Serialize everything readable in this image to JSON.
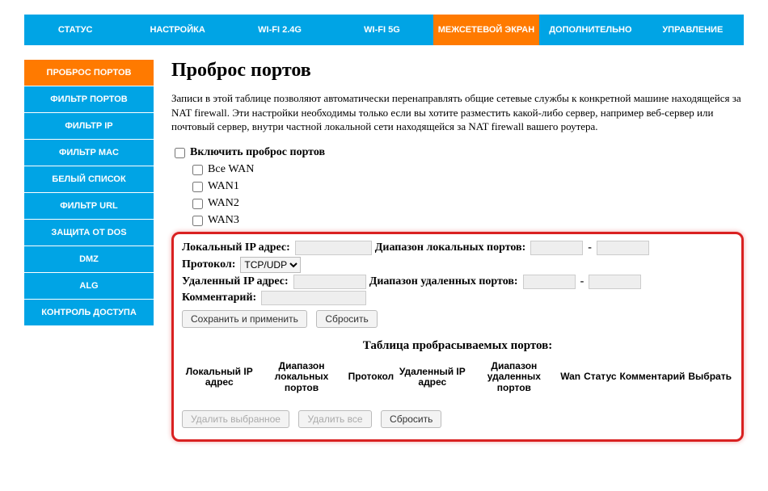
{
  "topnav": {
    "items": [
      {
        "label": "СТАТУС"
      },
      {
        "label": "НАСТРОЙКА"
      },
      {
        "label": "WI-FI 2.4G"
      },
      {
        "label": "WI-FI 5G"
      },
      {
        "label": "МЕЖСЕТЕВОЙ ЭКРАН",
        "active": true
      },
      {
        "label": "ДОПОЛНИТЕЛЬНО"
      },
      {
        "label": "УПРАВЛЕНИЕ"
      }
    ]
  },
  "sidebar": {
    "items": [
      {
        "label": "ПРОБРОС ПОРТОВ",
        "active": true
      },
      {
        "label": "ФИЛЬТР ПОРТОВ"
      },
      {
        "label": "ФИЛЬТР IP"
      },
      {
        "label": "ФИЛЬТР MAC"
      },
      {
        "label": "БЕЛЫЙ СПИСОК"
      },
      {
        "label": "ФИЛЬТР URL"
      },
      {
        "label": "ЗАЩИТА ОТ DOS"
      },
      {
        "label": "DMZ"
      },
      {
        "label": "ALG"
      },
      {
        "label": "КОНТРОЛЬ ДОСТУПА"
      }
    ]
  },
  "page_title": "Проброс портов",
  "description": "Записи в этой таблице позволяют автоматически перенаправлять общие сетевые службы к конкретной машине находящейся за NAT firewall. Эти настройки необходимы только если вы хотите разместить какой-либо сервер, например веб-сервер или почтовый сервер, внутри частной локальной сети находящейся за NAT firewall вашего роутера.",
  "checks": {
    "enable_label": "Включить проброс портов",
    "wan_all": "Все WAN",
    "wan1": "WAN1",
    "wan2": "WAN2",
    "wan3": "WAN3"
  },
  "form": {
    "local_ip_label": "Локальный IP адрес:",
    "local_ports_label": "Диапазон локальных портов:",
    "protocol_label": "Протокол:",
    "protocol_value": "TCP/UDP",
    "remote_ip_label": "Удаленный IP адрес:",
    "remote_ports_label": "Диапазон удаленных портов:",
    "comment_label": "Комментарий:",
    "save_btn": "Сохранить и применить",
    "reset_btn": "Сбросить"
  },
  "table": {
    "title": "Таблица пробрасываемых портов:",
    "headers": {
      "local_ip": "Локальный IP адрес",
      "local_ports": "Диапазон локальных портов",
      "protocol": "Протокол",
      "remote_ip": "Удаленный IP адрес",
      "remote_ports": "Диапазон удаленных портов",
      "wan": "Wan",
      "status": "Статус",
      "comment": "Комментарий",
      "select": "Выбрать"
    },
    "delete_selected": "Удалить выбранное",
    "delete_all": "Удалить все",
    "reset_btn": "Сбросить"
  }
}
